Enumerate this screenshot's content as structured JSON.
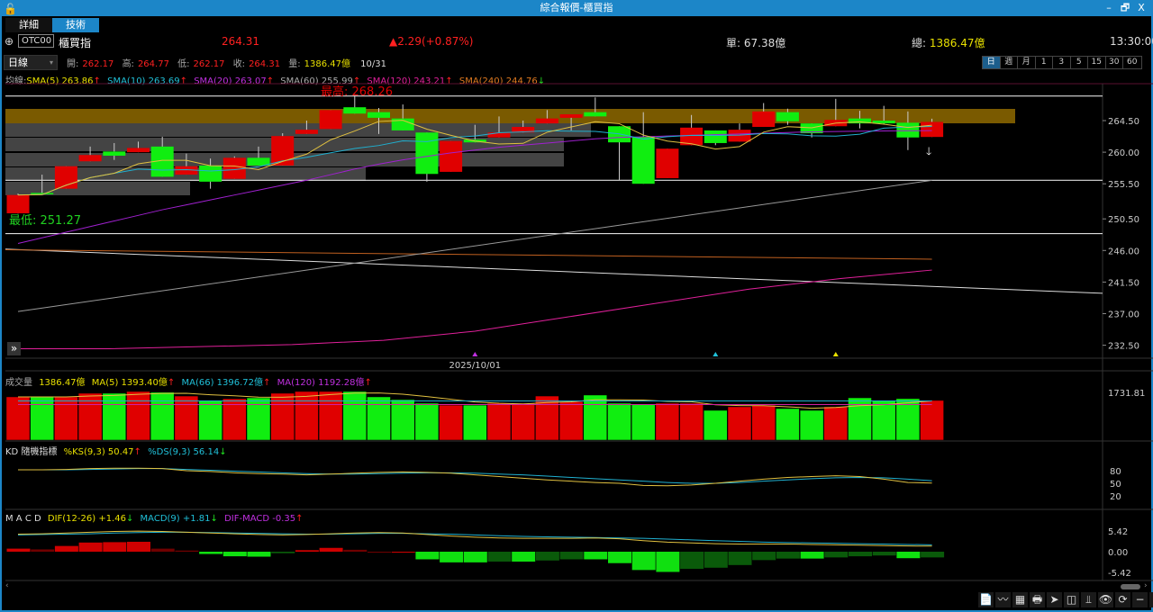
{
  "window": {
    "title": "綜合報價-櫃買指",
    "minimize": "–",
    "restore": "🗗",
    "close": "X"
  },
  "tabs": [
    {
      "label": "詳細"
    },
    {
      "label": "技術"
    }
  ],
  "quote": {
    "code": "OTC00",
    "name": "櫃買指",
    "price": "264.31",
    "change": "▲2.29(+0.87%)",
    "single_label": "單: ",
    "single": "67.38億",
    "total_label": "總: ",
    "total": "1386.47億",
    "time": "13:30:00"
  },
  "ohlc": {
    "period": "日線",
    "open_label": "開:",
    "open": "262.17",
    "high_label": "高:",
    "high": "264.77",
    "low_label": "低:",
    "low": "262.17",
    "close_label": "收:",
    "close": "264.31",
    "vol_label": "量:",
    "vol": "1386.47億",
    "date": "10/31"
  },
  "periods": [
    "日",
    "週",
    "月",
    "1",
    "3",
    "5",
    "15",
    "30",
    "60"
  ],
  "ma_legend": {
    "prefix": "均線:",
    "sma5": "SMA(5) 263.86",
    "sma10": "SMA(10) 263.69",
    "sma20": "SMA(20) 263.07",
    "sma60": "SMA(60) 255.99",
    "sma120": "SMA(120) 243.21",
    "sma240": "SMA(240) 244.76",
    "up": "↑",
    "down": "↓"
  },
  "vol_legend": {
    "label": "成交量",
    "value": "1386.47億",
    "ma5": "MA(5) 1393.40億",
    "ma66": "MA(66) 1396.72億",
    "ma120": "MA(120) 1192.28億"
  },
  "kd_legend": {
    "label": "KD 隨機指標",
    "k": "%KS(9,3) 50.47",
    "d": "%DS(9,3) 56.14"
  },
  "macd_legend": {
    "label": "M A C D",
    "dif": "DIF(12-26)  +1.46",
    "macd": "MACD(9)  +1.81",
    "osc": "DIF-MACD  -0.35"
  },
  "colors": {
    "up": "#e00000",
    "down": "#10ee10",
    "accent": "#1c86c8"
  },
  "chart_data": {
    "type": "candlestick",
    "high_label": "最高: 268.26",
    "low_label": "最低: 251.27",
    "date_label": "2025/10/01",
    "price_ticks": [
      "264.50",
      "260.00",
      "255.50",
      "250.50",
      "246.00",
      "241.50",
      "237.00",
      "232.50"
    ],
    "price_range": [
      231,
      270
    ],
    "candles": [
      [
        251.3,
        254.1,
        251.27,
        253.9
      ],
      [
        254.2,
        256.8,
        254.0,
        254.0
      ],
      [
        254.8,
        258.0,
        254.8,
        258.0
      ],
      [
        258.7,
        260.8,
        258.7,
        259.6
      ],
      [
        260.1,
        261.3,
        258.9,
        259.5
      ],
      [
        260.0,
        261.5,
        260.0,
        260.6
      ],
      [
        260.8,
        262.2,
        256.5,
        256.5
      ],
      [
        256.8,
        259.8,
        256.8,
        258.0
      ],
      [
        258.1,
        259.1,
        254.8,
        255.8
      ],
      [
        256.2,
        259.4,
        256.2,
        259.2
      ],
      [
        259.2,
        260.8,
        258.1,
        258.1
      ],
      [
        258.1,
        262.7,
        258.1,
        262.3
      ],
      [
        262.6,
        264.5,
        262.6,
        263.2
      ],
      [
        263.3,
        266.0,
        263.3,
        266.0
      ],
      [
        266.4,
        268.26,
        265.5,
        265.5
      ],
      [
        265.7,
        266.3,
        262.6,
        264.9
      ],
      [
        264.8,
        266.8,
        263.1,
        263.1
      ],
      [
        262.8,
        262.8,
        255.8,
        256.9
      ],
      [
        257.2,
        261.6,
        257.2,
        261.6
      ],
      [
        261.8,
        263.9,
        261.4,
        261.4
      ],
      [
        262.1,
        265.1,
        262.1,
        262.8
      ],
      [
        262.8,
        264.5,
        262.8,
        263.6
      ],
      [
        264.1,
        266.0,
        264.1,
        264.8
      ],
      [
        264.9,
        265.4,
        263.1,
        265.4
      ],
      [
        265.7,
        267.8,
        265.1,
        265.1
      ],
      [
        263.7,
        263.7,
        256.0,
        261.4
      ],
      [
        262.2,
        265.7,
        255.5,
        255.5
      ],
      [
        256.3,
        260.5,
        256.3,
        260.5
      ],
      [
        261.0,
        265.3,
        261.0,
        263.5
      ],
      [
        263.1,
        263.1,
        261.0,
        261.3
      ],
      [
        261.5,
        264.1,
        261.5,
        263.2
      ],
      [
        263.6,
        267.0,
        263.6,
        265.8
      ],
      [
        265.7,
        266.2,
        263.9,
        264.4
      ],
      [
        264.1,
        264.1,
        262.1,
        262.7
      ],
      [
        263.7,
        267.6,
        263.7,
        264.6
      ],
      [
        264.8,
        265.9,
        263.4,
        264.1
      ],
      [
        264.5,
        266.6,
        264.0,
        264.1
      ],
      [
        264.2,
        265.8,
        260.3,
        262.1
      ],
      [
        262.17,
        264.77,
        262.17,
        264.31
      ]
    ],
    "sma20": [
      247,
      247.8,
      248.6,
      249.4,
      250.2,
      251,
      251.8,
      252.5,
      253.2,
      253.9,
      254.6,
      255.3,
      256,
      256.8,
      257.6,
      258.3,
      258.9,
      259.4,
      259.9,
      260.3,
      260.7,
      261,
      261.3,
      261.6,
      261.9,
      262.1,
      262.2,
      262.3,
      262.4,
      262.5,
      262.6,
      262.7,
      262.8,
      262.9,
      262.95,
      263,
      263.02,
      263.05,
      263.07
    ],
    "sma60": [
      237.3,
      255.99
    ],
    "sma120": [
      232,
      232,
      232.3,
      232.6,
      233.2,
      234.5,
      236.5,
      238.5,
      240.5,
      242,
      243.21
    ],
    "sma240": [
      246.1,
      244.76
    ],
    "trendline": [
      246.2,
      239.9
    ],
    "levels": [
      268.0,
      256.0,
      248.4
    ],
    "volume_tick": "1731.81",
    "volume": [
      1570,
      1570,
      1570,
      1700,
      1700,
      1765,
      1735,
      1600,
      1440,
      1500,
      1535,
      1700,
      1765,
      1765,
      1765,
      1570,
      1470,
      1340,
      1270,
      1270,
      1340,
      1340,
      1600,
      1400,
      1635,
      1340,
      1305,
      1340,
      1340,
      1080,
      1210,
      1270,
      1145,
      1080,
      1210,
      1535,
      1440,
      1505,
      1440
    ],
    "kd_ticks": [
      "80",
      "50",
      "20"
    ],
    "k": [
      82,
      82,
      83,
      85,
      86,
      86,
      85,
      80,
      78,
      75,
      73,
      72,
      70,
      72,
      74,
      76,
      77,
      76,
      74,
      70,
      66,
      62,
      58,
      55,
      52,
      50,
      45,
      44,
      46,
      50,
      55,
      60,
      64,
      66,
      68,
      66,
      60,
      52,
      50.47
    ],
    "d": [
      82,
      82,
      82,
      83,
      84,
      85,
      85,
      83,
      81,
      79,
      77,
      75,
      73,
      72,
      72,
      73,
      74,
      75,
      75,
      74,
      72,
      70,
      67,
      64,
      61,
      58,
      55,
      52,
      50,
      50,
      52,
      55,
      58,
      61,
      63,
      64,
      63,
      60,
      56.14
    ],
    "macd_ticks": [
      "5.42",
      "0.00",
      "-5.42"
    ],
    "hist": [
      0.8,
      0.6,
      1.5,
      2.4,
      2.5,
      2.6,
      0.8,
      0.3,
      -0.6,
      -1.2,
      -1.3,
      -0.4,
      0.4,
      1.0,
      0.5,
      0,
      0,
      -2.0,
      -2.8,
      -2.8,
      -2.6,
      -2.6,
      -2.3,
      -2.0,
      -2.0,
      -3.0,
      -4.8,
      -5.3,
      -4.5,
      -4.2,
      -3.5,
      -2.2,
      -1.8,
      -1.8,
      -1.5,
      -1.2,
      -1.0,
      -1.7,
      -1.5
    ],
    "dif": [
      4.6,
      4.7,
      4.9,
      5.1,
      5.3,
      5.4,
      5.3,
      5.1,
      4.9,
      4.7,
      4.5,
      4.4,
      4.5,
      4.7,
      4.9,
      5.0,
      4.9,
      4.5,
      4.1,
      3.8,
      3.6,
      3.5,
      3.5,
      3.5,
      3.6,
      3.4,
      2.9,
      2.5,
      2.3,
      2.1,
      2.0,
      2.0,
      2.0,
      1.9,
      1.8,
      1.7,
      1.6,
      1.5,
      1.46
    ],
    "macd": [
      4.4,
      4.5,
      4.6,
      4.7,
      4.9,
      5.0,
      5.1,
      5.1,
      5.0,
      4.9,
      4.8,
      4.7,
      4.6,
      4.6,
      4.7,
      4.8,
      4.8,
      4.7,
      4.6,
      4.4,
      4.2,
      4.0,
      3.9,
      3.8,
      3.7,
      3.6,
      3.5,
      3.3,
      3.1,
      2.9,
      2.7,
      2.5,
      2.4,
      2.3,
      2.2,
      2.1,
      2.0,
      1.9,
      1.81
    ],
    "markers": [
      {
        "index": 19,
        "color": "#c030e0"
      },
      {
        "index": 29,
        "color": "#20c0d8"
      },
      {
        "index": 34,
        "color": "#e8e000"
      }
    ]
  },
  "toolbar": [
    "📄",
    "〰",
    "▦",
    "🖶",
    "➤",
    "◫",
    "⫫",
    "👁",
    "⟳",
    "−",
    "+"
  ]
}
